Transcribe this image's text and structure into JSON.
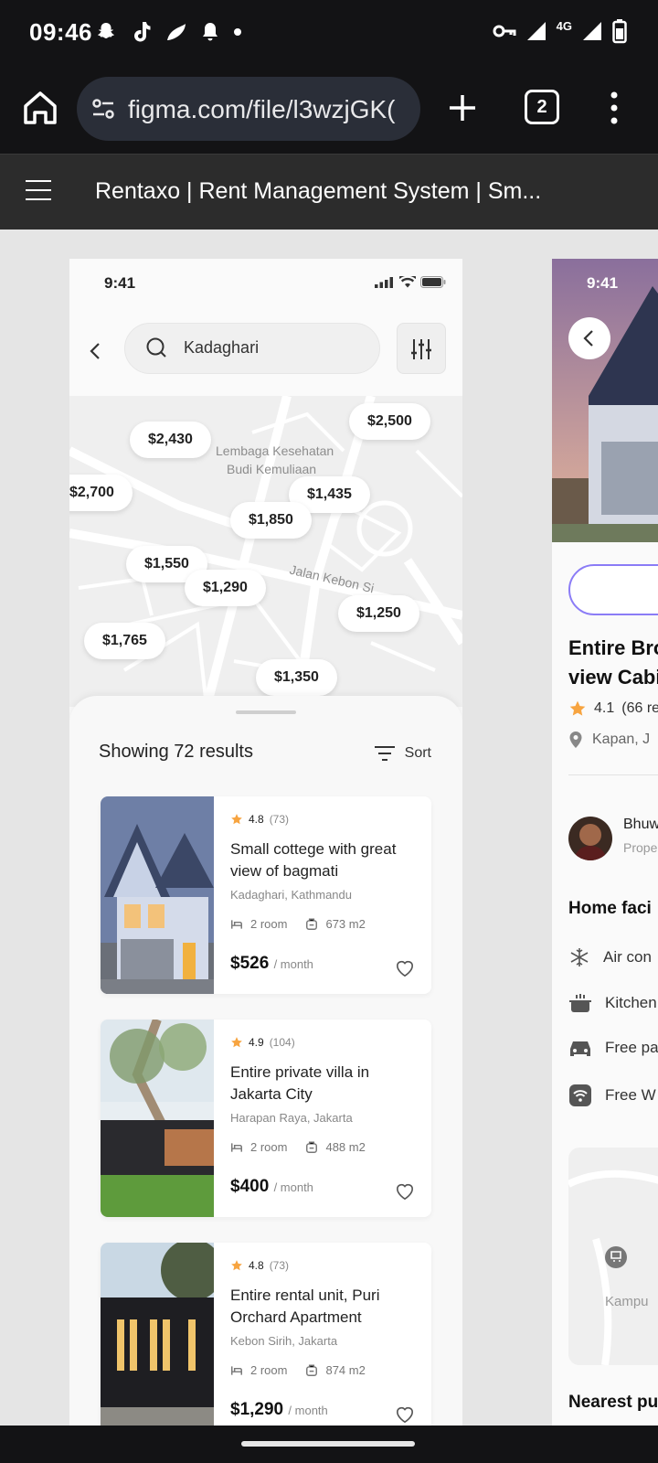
{
  "status_bar": {
    "time": "09:46",
    "network": "4G",
    "left_icons": [
      "snapchat-icon",
      "tiktok-icon",
      "leaf-icon",
      "bell-icon",
      "dot-icon"
    ],
    "right_icons": [
      "vpn-key-icon",
      "signal-icon",
      "signal-icon",
      "battery-icon"
    ]
  },
  "browser": {
    "url": "figma.com/file/l3wzjGK(",
    "tab_count": "2"
  },
  "figma": {
    "file_title": "Rentaxo | Rent Management System | Sm..."
  },
  "frame1": {
    "status_time": "9:41",
    "search_value": "Kadaghari",
    "map": {
      "labels": [
        "Lembaga Kesehatan",
        "Budi Kemuliaan",
        "Jalan Kebon Si"
      ],
      "pins": [
        "$2,430",
        "$2,500",
        "$2,700",
        "$1,435",
        "$1,850",
        "$1,550",
        "$1,290",
        "$1,250",
        "$1,765",
        "$1,350"
      ]
    },
    "results_label": "Showing 72 results",
    "sort_label": "Sort",
    "listings": [
      {
        "rating": "4.8",
        "reviews": "(73)",
        "title": "Small cottege with great view of bagmati",
        "location": "Kadaghari, Kathmandu",
        "rooms": "2 room",
        "area": "673 m2",
        "price": "$526",
        "per": "/ month"
      },
      {
        "rating": "4.9",
        "reviews": "(104)",
        "title": "Entire private villa in Jakarta City",
        "location": "Harapan Raya, Jakarta",
        "rooms": "2 room",
        "area": "488 m2",
        "price": "$400",
        "per": "/ month"
      },
      {
        "rating": "4.8",
        "reviews": "(73)",
        "title": "Entire rental unit, Puri Orchard Apartment",
        "location": "Kebon Sirih, Jakarta",
        "rooms": "2 room",
        "area": "874 m2",
        "price": "$1,290",
        "per": "/ month"
      }
    ]
  },
  "frame2": {
    "status_time": "9:41",
    "title_line1": "Entire Bro",
    "title_line2": "view Cabi",
    "rating": "4.1",
    "reviews": "(66 re",
    "location": "Kapan, J",
    "owner_name": "Bhuw",
    "owner_role": "Prope",
    "facilities_title": "Home faci",
    "facilities": [
      {
        "icon": "snowflake-icon",
        "label": "Air con"
      },
      {
        "icon": "pot-icon",
        "label": "Kitchen"
      },
      {
        "icon": "car-icon",
        "label": "Free pa"
      },
      {
        "icon": "wifi-icon",
        "label": "Free W"
      }
    ],
    "map_label": "Kampu",
    "nearest_title": "Nearest pu"
  },
  "colors": {
    "accent": "#8b7cf6",
    "star": "#f7a440",
    "canvas": "#e5e5e5"
  }
}
